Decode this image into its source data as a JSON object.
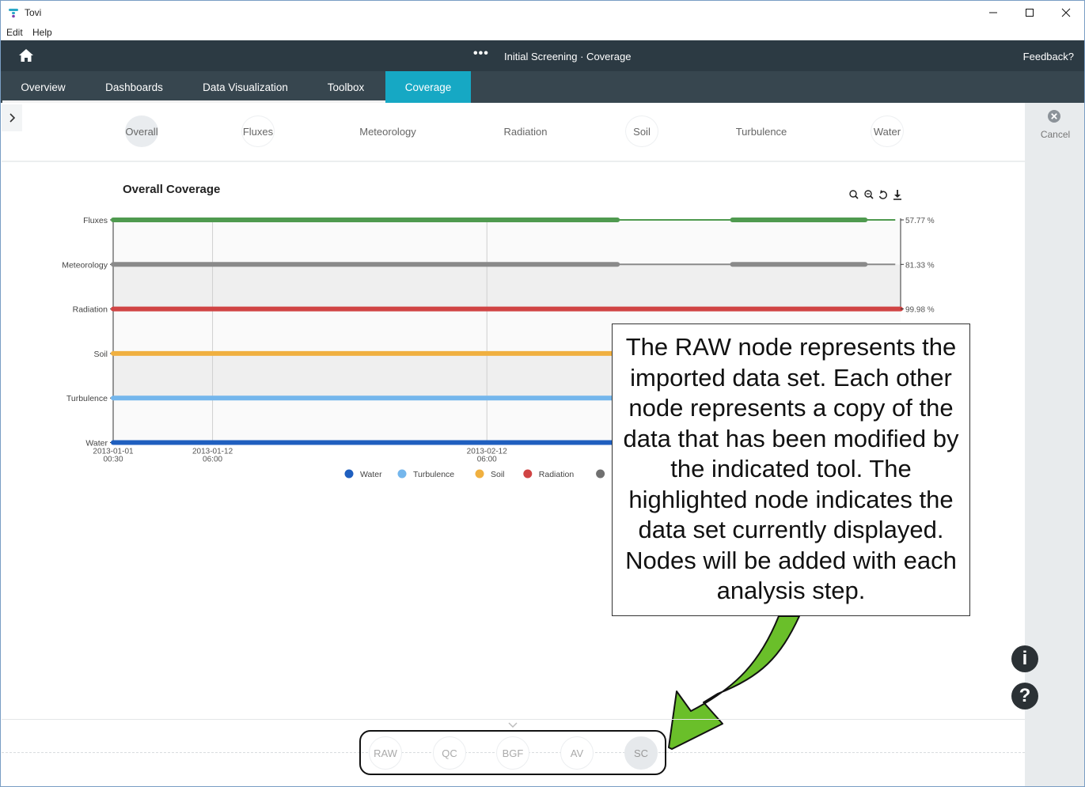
{
  "window": {
    "title": "Tovi"
  },
  "menu": {
    "items": [
      "Edit",
      "Help"
    ]
  },
  "header": {
    "breadcrumb": "Initial Screening · Coverage",
    "feedback": "Feedback?"
  },
  "tabs": [
    "Overview",
    "Dashboards",
    "Data Visualization",
    "Toolbox",
    "Coverage"
  ],
  "active_tab": "Coverage",
  "subtabs": [
    "Overall",
    "Fluxes",
    "Meteorology",
    "Radiation",
    "Soil",
    "Turbulence",
    "Water"
  ],
  "active_subtab": "Overall",
  "right_panel": {
    "cancel_label": "Cancel",
    "info_label": "i",
    "help_label": "?"
  },
  "chart_title": "Overall Coverage",
  "chart_data": {
    "type": "timeline",
    "title": "Overall Coverage",
    "categories": [
      "Fluxes",
      "Meteorology",
      "Radiation",
      "Soil",
      "Turbulence",
      "Water"
    ],
    "x_ticks": [
      {
        "line1": "2013-01-01",
        "line2": "00:30"
      },
      {
        "line1": "2013-01-12",
        "line2": "06:00"
      },
      {
        "line1": "2013-02-12",
        "line2": "06:00"
      }
    ],
    "right_labels": [
      "57.77 %",
      "81.33 %",
      "99.98 %"
    ],
    "series": [
      {
        "name": "Fluxes",
        "color": "#4f9a4f",
        "segments": [
          [
            "2013-01-01 00:30",
            "2013-02-27"
          ],
          [
            "2013-03-12",
            "2013-03-27"
          ]
        ]
      },
      {
        "name": "Meteorology",
        "color": "#8a8a8a",
        "segments": [
          [
            "2013-01-01 00:30",
            "2013-02-27"
          ],
          [
            "2013-03-12",
            "2013-03-27"
          ]
        ]
      },
      {
        "name": "Radiation",
        "color": "#d04444",
        "segments": [
          [
            "2013-01-01 00:30",
            "2013-03-31"
          ]
        ]
      },
      {
        "name": "Soil",
        "color": "#f0b040",
        "segments": [
          [
            "2013-01-01 00:30",
            "2013-03-31"
          ]
        ]
      },
      {
        "name": "Turbulence",
        "color": "#74b6ec",
        "segments": [
          [
            "2013-01-01 00:30",
            "2013-03-31"
          ]
        ]
      },
      {
        "name": "Water",
        "color": "#1f5fbf",
        "segments": [
          [
            "2013-01-01 00:30",
            "2013-03-31"
          ]
        ]
      }
    ],
    "legend": [
      "Water",
      "Turbulence",
      "Soil",
      "Radiation",
      "Meteorolo"
    ],
    "legend_colors": [
      "#1f5fbf",
      "#74b6ec",
      "#f0b040",
      "#d04444",
      "#707070"
    ],
    "legend_position": "bottom"
  },
  "callout": "The RAW node represents the imported data set. Each other node represents a copy of the data that has been modified by the indicated tool. The highlighted node indicates the data set currently displayed. Nodes will be added with each analysis step.",
  "nodes": [
    "RAW",
    "QC",
    "BGF",
    "AV",
    "SC"
  ],
  "active_node": "SC"
}
